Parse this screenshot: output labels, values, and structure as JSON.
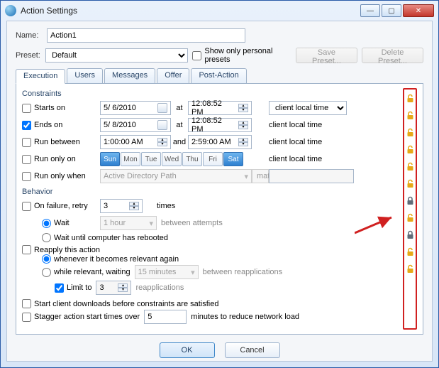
{
  "window": {
    "title": "Action Settings"
  },
  "header": {
    "name_label": "Name:",
    "name_value": "Action1",
    "preset_label": "Preset:",
    "preset_value": "Default",
    "show_personal": "Show only personal presets",
    "save_preset": "Save Preset...",
    "delete_preset": "Delete Preset..."
  },
  "tabs": [
    "Execution",
    "Users",
    "Messages",
    "Offer",
    "Post-Action"
  ],
  "exec": {
    "constraints_label": "Constraints",
    "starts_on": "Starts on",
    "ends_on": "Ends on",
    "run_between": "Run between",
    "run_only_on": "Run only on",
    "run_only_when": "Run only when",
    "at": "at",
    "and": "and",
    "start_date": "5/ 6/2010",
    "end_date": "5/ 8/2010",
    "start_time": "12:08:52 PM",
    "end_time": "12:08:52 PM",
    "between_start": "1:00:00 AM",
    "between_end": "2:59:00 AM",
    "time_basis": "client local time",
    "days": [
      "Sun",
      "Mon",
      "Tue",
      "Wed",
      "Thu",
      "Fri",
      "Sat"
    ],
    "days_on": [
      true,
      false,
      false,
      false,
      false,
      false,
      true
    ],
    "when_path": "Active Directory Path",
    "when_op": "matches",
    "behavior_label": "Behavior",
    "on_failure": "On failure, retry",
    "retry_count": "3",
    "times": "times",
    "wait": "Wait",
    "wait_dur": "1 hour",
    "between_attempts": "between attempts",
    "wait_reboot": "Wait until computer has rebooted",
    "reapply": "Reapply this action",
    "whenever": "whenever it becomes relevant again",
    "while_rel": "while relevant, waiting",
    "reapply_dur": "15 minutes",
    "between_reapps": "between reapplications",
    "limit_to": "Limit to",
    "limit_count": "3",
    "reapplications": "reapplications",
    "start_downloads": "Start client downloads before constraints are satisfied",
    "stagger": "Stagger action start times over",
    "stagger_val": "5",
    "stagger_tail": "minutes to reduce network load"
  },
  "locks": [
    "open",
    "open",
    "open",
    "open",
    "open",
    "open",
    "closed",
    "open",
    "closed",
    "open",
    "open"
  ],
  "footer": {
    "ok": "OK",
    "cancel": "Cancel"
  }
}
